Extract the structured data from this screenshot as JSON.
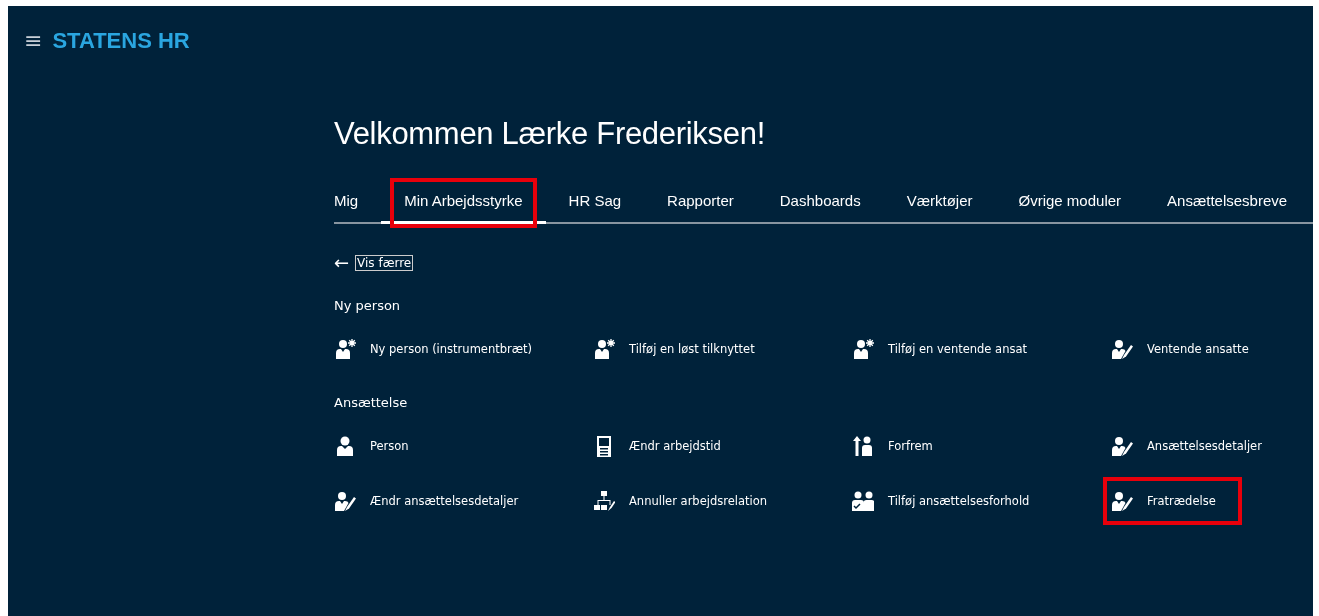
{
  "header": {
    "menu_icon": "≡",
    "brand": "STATENS HR"
  },
  "welcome": "Velkommen Lærke Frederiksen!",
  "tabs": [
    {
      "label": "Mig",
      "selected": false,
      "highlighted": false
    },
    {
      "label": "Min Arbejdsstyrke",
      "selected": true,
      "highlighted": true
    },
    {
      "label": "HR Sag",
      "selected": false,
      "highlighted": false
    },
    {
      "label": "Rapporter",
      "selected": false,
      "highlighted": false
    },
    {
      "label": "Dashboards",
      "selected": false,
      "highlighted": false
    },
    {
      "label": "Værktøjer",
      "selected": false,
      "highlighted": false
    },
    {
      "label": "Øvrige moduler",
      "selected": false,
      "highlighted": false
    },
    {
      "label": "Ansættelsesbreve",
      "selected": false,
      "highlighted": false
    }
  ],
  "back_link": {
    "arrow": "←",
    "label": "Vis færre"
  },
  "sections": [
    {
      "title": "Ny person",
      "items": [
        {
          "label": "Ny person (instrumentbræt)",
          "kind": "person-add",
          "highlighted": false
        },
        {
          "label": "Tilføj en løst tilknyttet",
          "kind": "person-add",
          "highlighted": false
        },
        {
          "label": "Tilføj en ventende ansat",
          "kind": "person-add",
          "highlighted": false
        },
        {
          "label": "Ventende ansatte",
          "kind": "person-edit",
          "highlighted": false
        }
      ]
    },
    {
      "title": "Ansættelse",
      "items": [
        {
          "label": "Person",
          "kind": "person",
          "highlighted": false
        },
        {
          "label": "Ændr arbejdstid",
          "kind": "id-card",
          "highlighted": false
        },
        {
          "label": "Forfrem",
          "kind": "promote",
          "highlighted": false
        },
        {
          "label": "Ansættelsesdetaljer",
          "kind": "person-edit",
          "highlighted": false
        },
        {
          "label": "Ændr ansættelsesdetaljer",
          "kind": "person-edit",
          "highlighted": false
        },
        {
          "label": "Annuller arbejdsrelation",
          "kind": "org-chart",
          "highlighted": false
        },
        {
          "label": "Tilføj ansættelsesforhold",
          "kind": "two-persons",
          "highlighted": false
        },
        {
          "label": "Fratrædelse",
          "kind": "person-edit",
          "highlighted": true
        }
      ]
    }
  ]
}
